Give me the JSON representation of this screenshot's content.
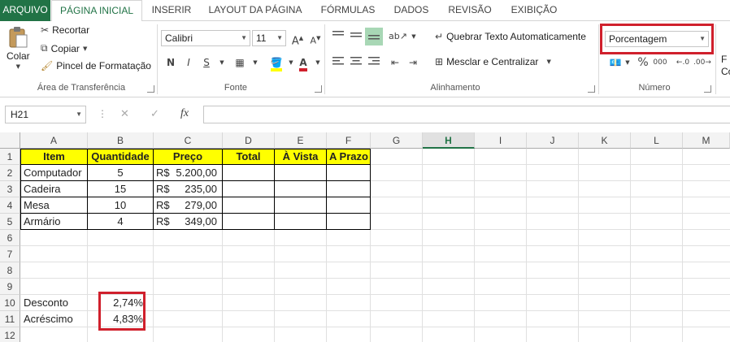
{
  "tabs": [
    "ARQUIVO",
    "PÁGINA INICIAL",
    "INSERIR",
    "LAYOUT DA PÁGINA",
    "FÓRMULAS",
    "DADOS",
    "REVISÃO",
    "EXIBIÇÃO"
  ],
  "clipboard": {
    "paste": "Colar",
    "cut": "Recortar",
    "copy": "Copiar",
    "format_painter": "Pincel de Formatação",
    "label": "Área de Transferência"
  },
  "font": {
    "name": "Calibri",
    "size": "11",
    "bold": "N",
    "italic": "I",
    "underline": "S",
    "grow": "A",
    "shrink": "A",
    "color_letter": "A",
    "label": "Fonte"
  },
  "alignment": {
    "wrap": "Quebrar Texto Automaticamente",
    "merge": "Mesclar e Centralizar",
    "label": "Alinhamento"
  },
  "number": {
    "format": "Porcentagem",
    "percent": "%",
    "thousands": "000",
    "label": "Número"
  },
  "styles_partial": {
    "line1": "F",
    "line2": "Co"
  },
  "formula_bar": {
    "name_box": "H21",
    "fx": "fx",
    "cancel": "✕",
    "enter": "✓"
  },
  "columns": [
    "A",
    "B",
    "C",
    "D",
    "E",
    "F",
    "G",
    "H",
    "I",
    "J",
    "K",
    "L",
    "M"
  ],
  "rows": [
    "1",
    "2",
    "3",
    "4",
    "5",
    "6",
    "7",
    "8",
    "9",
    "10",
    "11",
    "12"
  ],
  "selected_column": "H",
  "table": {
    "headers": [
      "Item",
      "Quantidade",
      "Preço",
      "Total",
      "À Vista",
      "A Prazo"
    ],
    "rows": [
      {
        "item": "Computador",
        "qty": "5",
        "currency": "R$",
        "price": "5.200,00"
      },
      {
        "item": "Cadeira",
        "qty": "15",
        "currency": "R$",
        "price": "235,00"
      },
      {
        "item": "Mesa",
        "qty": "10",
        "currency": "R$",
        "price": "279,00"
      },
      {
        "item": "Armário",
        "qty": "4",
        "currency": "R$",
        "price": "349,00"
      }
    ]
  },
  "params": {
    "discount_label": "Desconto",
    "discount_value": "2,74%",
    "surcharge_label": "Acréscimo",
    "surcharge_value": "4,83%"
  },
  "colors": {
    "accent": "#217346",
    "highlight": "#d0202c",
    "header_fill": "#ffff00"
  }
}
